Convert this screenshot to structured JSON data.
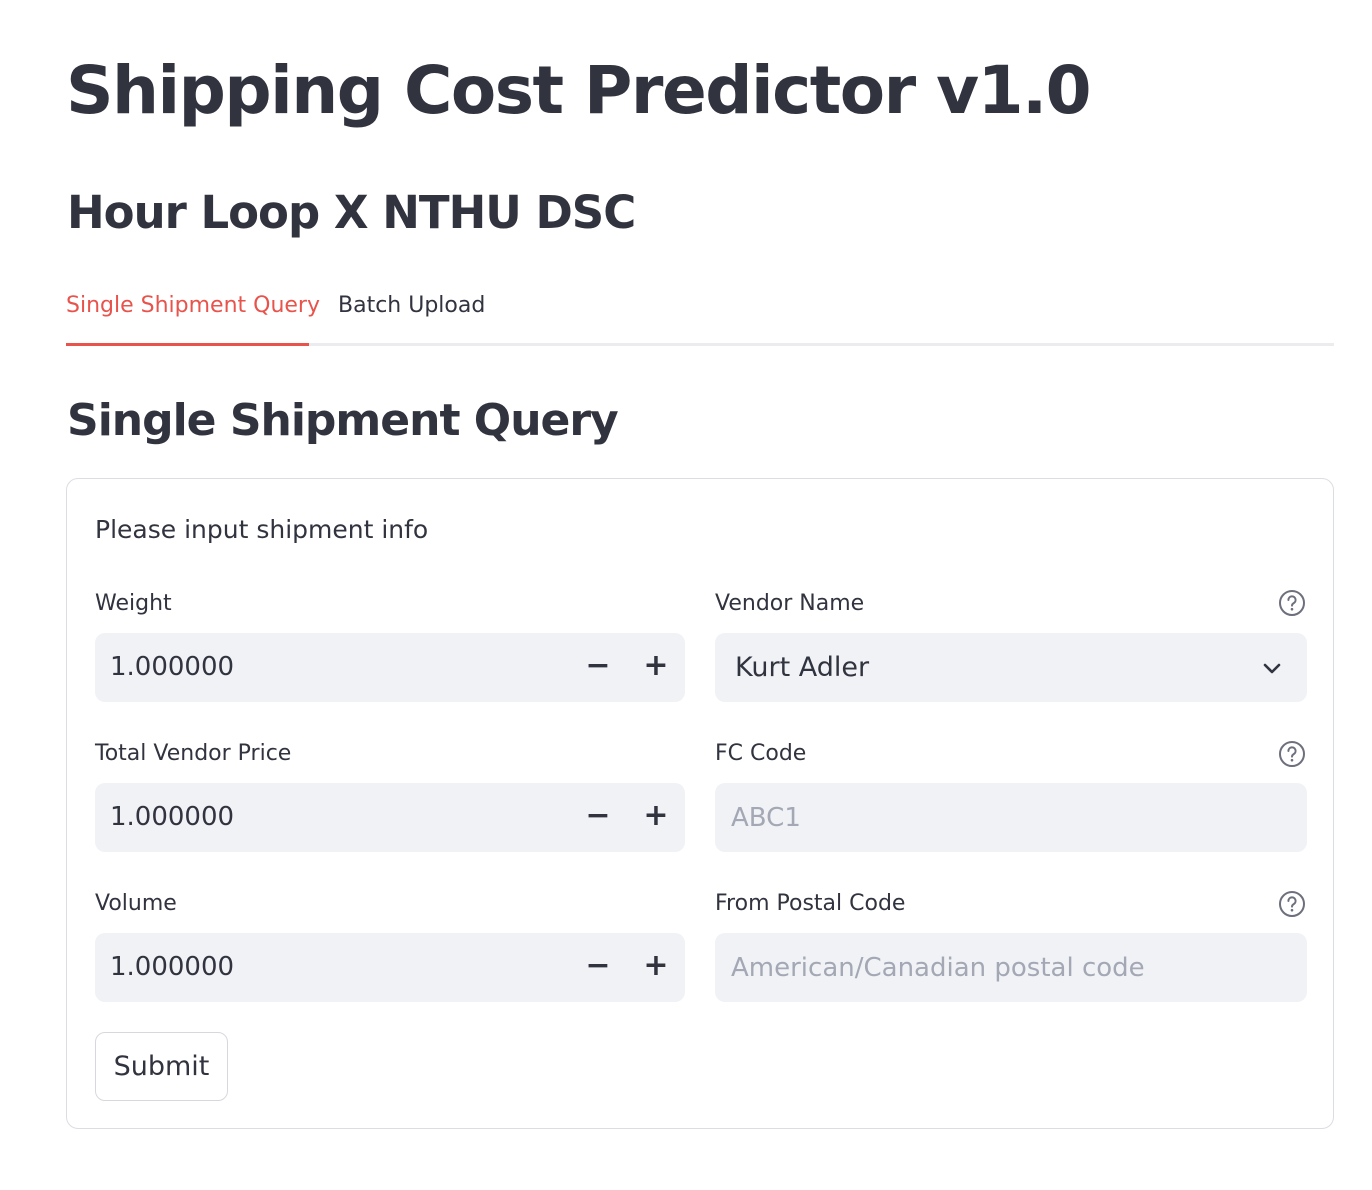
{
  "header": {
    "title": "Shipping Cost Predictor v1.0",
    "subtitle": "Hour Loop X NTHU DSC"
  },
  "tabs": [
    {
      "label": "Single Shipment Query",
      "active": true
    },
    {
      "label": "Batch Upload",
      "active": false
    }
  ],
  "section": {
    "heading": "Single Shipment Query"
  },
  "form": {
    "caption": "Please input shipment info",
    "weight": {
      "label": "Weight",
      "value": "1.000000",
      "minus": "−",
      "plus": "+"
    },
    "total_vendor_price": {
      "label": "Total Vendor Price",
      "value": "1.000000",
      "minus": "−",
      "plus": "+"
    },
    "volume": {
      "label": "Volume",
      "value": "1.000000",
      "minus": "−",
      "plus": "+"
    },
    "vendor_name": {
      "label": "Vendor Name",
      "selected": "Kurt Adler"
    },
    "fc_code": {
      "label": "FC Code",
      "value": "",
      "placeholder": "ABC1"
    },
    "from_postal_code": {
      "label": "From Postal Code",
      "value": "",
      "placeholder": "American/Canadian postal code"
    },
    "submit_label": "Submit"
  },
  "colors": {
    "accent": "#e8534c",
    "input_bg": "#f0f2f6",
    "text": "#31333f",
    "placeholder": "#a3a8b4"
  },
  "icons": {
    "help": "help-circle-icon",
    "chevron": "chevron-down-icon"
  }
}
